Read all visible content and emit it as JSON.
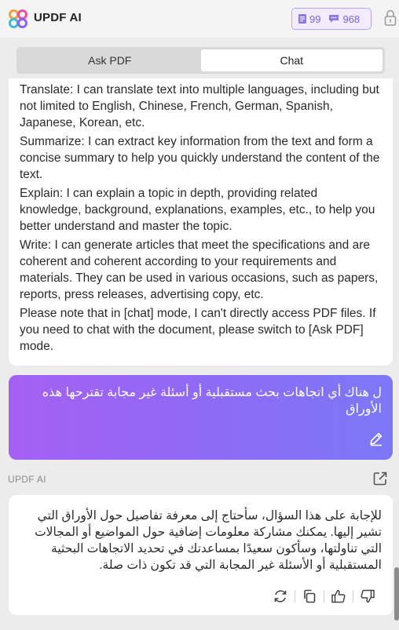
{
  "header": {
    "app_title": "UPDF AI",
    "credits": {
      "docs": "99",
      "chats": "968"
    }
  },
  "tabs": [
    {
      "label": "Ask PDF",
      "active": false
    },
    {
      "label": "Chat",
      "active": true
    }
  ],
  "ai_message": {
    "paragraphs": [
      "Translate: I can translate text into multiple languages, including but not limited to English, Chinese, French, German, Spanish, Japanese, Korean, etc.",
      "Summarize: I can extract key information from the text and form a concise summary to help you quickly understand the content of the text.",
      "Explain: I can explain a topic in depth, providing related knowledge, background, explanations, examples, etc., to help you better understand and master the topic.",
      "Write: I can generate articles that meet the specifications and are coherent and coherent according to your requirements and materials. They can be used in various occasions, such as papers, reports, press releases, advertising copy, etc.",
      "Please note that in [chat] mode, I can't directly access PDF files. If you need to chat with the document, please switch to [Ask PDF] mode."
    ]
  },
  "user_message": {
    "text": "ل هناك أي اتجاهات بحث مستقبلية أو أسئلة غير مجابة تقترحها هذه الأوراق"
  },
  "ai_reply": {
    "sender_label": "UPDF AI",
    "text": "للإجابة على هذا السؤال، سأحتاج إلى معرفة تفاصيل حول الأوراق التي تشير إليها. يمكنك مشاركة معلومات إضافية حول المواضيع أو المجالات التي تناولتها، وسأكون سعيدًا بمساعدتك في تحديد الاتجاهات البحثية المستقبلية أو الأسئلة غير المجابة التي قد تكون ذات صلة."
  },
  "colors": {
    "accent": "#8f6af5",
    "bubble_start": "#a560f2",
    "bubble_end": "#7b78f7"
  }
}
